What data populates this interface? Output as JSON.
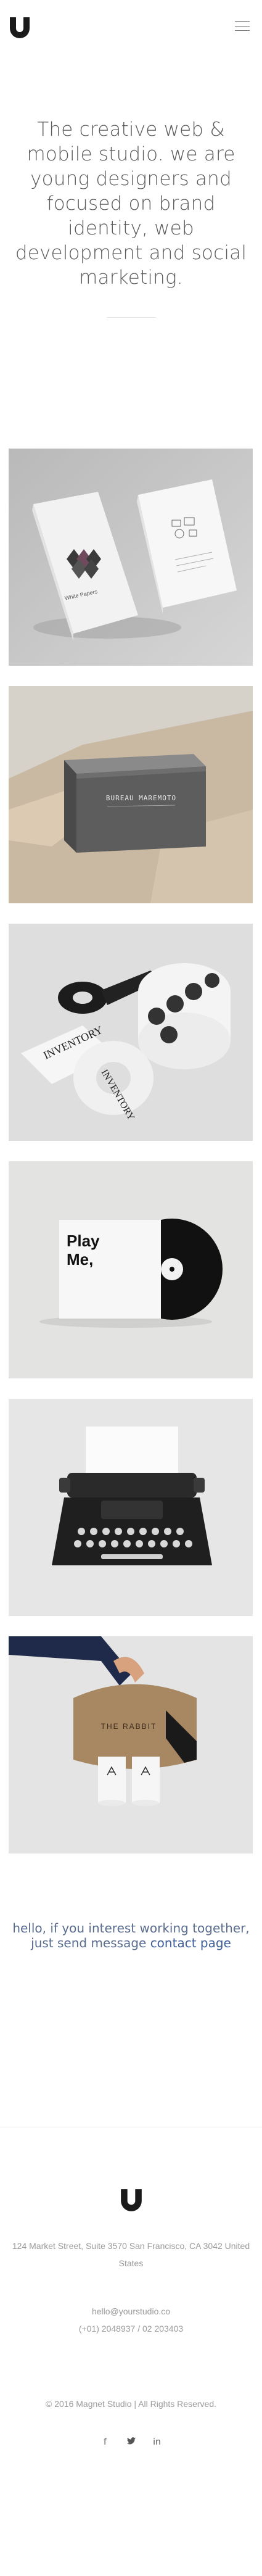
{
  "header": {
    "logo_icon": "magnet-u-logo",
    "menu_icon": "hamburger-menu-icon"
  },
  "hero": {
    "text": "The creative web & mobile studio. we are young designers and focused on brand identity, web development and social marketing."
  },
  "portfolio": {
    "items": [
      {
        "subject": "business-cards-mockup",
        "texts": [
          "White Papers"
        ]
      },
      {
        "subject": "box-business-cards",
        "texts": [
          "BUREAU MAREMOTO"
        ]
      },
      {
        "subject": "sticker-tape-rolls",
        "texts": [
          "INVENTORY"
        ]
      },
      {
        "subject": "cd-sleeve",
        "texts": [
          "Play",
          "Me,"
        ]
      },
      {
        "subject": "typewriter"
      },
      {
        "subject": "coffee-carrier",
        "texts": [
          "THE RABBIT"
        ]
      }
    ]
  },
  "contact": {
    "text_before": "hello, if you interest working together, just send message ",
    "link_text": "contact page"
  },
  "footer": {
    "address": "124 Market Street, Suite 3570 San Francisco, CA 3042 United States",
    "email": "hello@yourstudio.co",
    "phone": "(+01) 2048937 / 02 203403",
    "copyright": "© 2016 Magnet Studio | All Rights Reserved.",
    "social": [
      {
        "icon": "facebook-icon",
        "glyph": "f"
      },
      {
        "icon": "twitter-icon",
        "glyph": "🐦"
      },
      {
        "icon": "linkedin-icon",
        "glyph": "in"
      }
    ]
  },
  "colors": {
    "accent": "#3e5e96",
    "text_muted": "#9a9a9a",
    "hero_text": "#5c5c5c"
  }
}
